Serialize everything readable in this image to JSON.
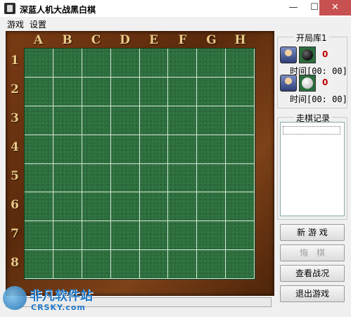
{
  "window": {
    "title": "深蓝人机大战黑白棋",
    "min_glyph": "—",
    "max_glyph": "☐",
    "close_glyph": "✕"
  },
  "menu": {
    "items": [
      "游戏",
      "设置"
    ]
  },
  "board": {
    "columns": [
      "A",
      "B",
      "C",
      "D",
      "E",
      "F",
      "G",
      "H"
    ],
    "rows": [
      "1",
      "2",
      "3",
      "4",
      "5",
      "6",
      "7",
      "8"
    ],
    "size": 8
  },
  "status_panel": {
    "title": "开局库1",
    "black": {
      "count": "0",
      "time": "时间[00: 00]"
    },
    "white": {
      "count": "0",
      "time": "时间[00: 00]"
    }
  },
  "record_panel": {
    "title": "走棋记录",
    "entries": []
  },
  "buttons": {
    "new_game": "新 游 戏",
    "undo": "悔　棋",
    "view_status": "查看战况",
    "exit": "退出游戏"
  },
  "watermark": {
    "line1": "非凡软件站",
    "line2": "CRSKY.com"
  },
  "colors": {
    "board_green": "#2b6e3c",
    "frame_brown": "#6b3410",
    "count_red": "#c00000"
  }
}
